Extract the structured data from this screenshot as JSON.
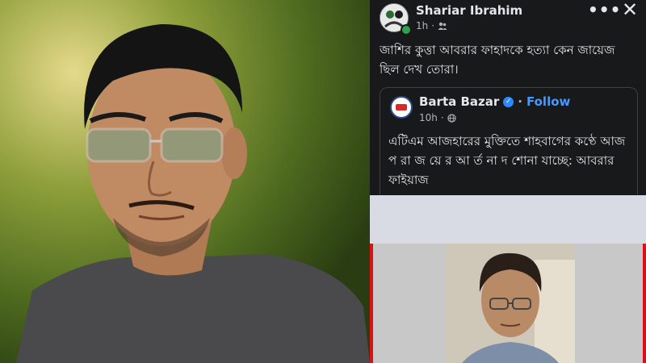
{
  "post": {
    "author": "Shariar Ibrahim",
    "time": "1h",
    "privacy_icon": "friends-icon",
    "more_icon": "more-options-icon",
    "close_icon": "close-icon",
    "text": "জাশির কুত্তা আবরার ফাহাদকে হত্যা কেন জায়েজ ছিল দেখ তোরা।"
  },
  "shared_post": {
    "page_name": "Barta Bazar",
    "verified_icon": "verified-badge-icon",
    "follow_label": "Follow",
    "time": "10h",
    "privacy_icon": "globe-icon",
    "text": "এটিএম আজহারের মুক্তিতে শাহবাগের কণ্ঠে আজ প রা জ য়ে র আ র্ত না দ শোনা যাচ্ছে: আবরার ফাইয়াজ"
  },
  "colors": {
    "background": "#18191a",
    "text": "#e4e6eb",
    "secondary_text": "#b0b3b8",
    "link_blue": "#4599ff",
    "online_green": "#31a24c",
    "frame_red": "#dd1111"
  }
}
